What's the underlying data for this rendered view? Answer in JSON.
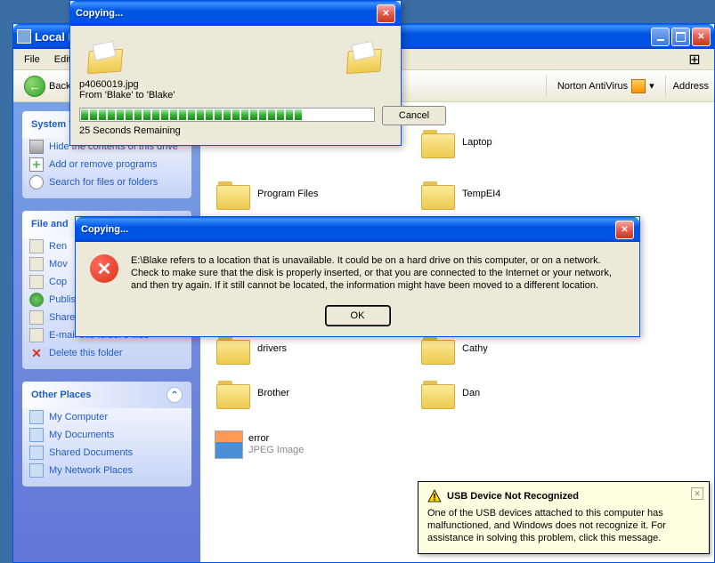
{
  "explorer": {
    "title": "Local Di",
    "menu": {
      "file": "File",
      "edit": "Edit"
    },
    "toolbar": {
      "back": "Back",
      "norton": "Norton AntiVirus",
      "address": "Address"
    },
    "panels": {
      "system": {
        "header": "System Tasks",
        "hide": "Hide the contents of this drive",
        "addremove": "Add or remove programs",
        "search": "Search for files or folders"
      },
      "file": {
        "header": "File and",
        "rename": "Ren",
        "move": "Mov",
        "copy": "Cop",
        "publish": "Publish this folder to the Web",
        "share": "Share this folder",
        "email": "E-mail this folder's files",
        "delete": "Delete this folder"
      },
      "other": {
        "header": "Other Places",
        "mycomputer": "My Computer",
        "mydocs": "My Documents",
        "shared": "Shared Documents",
        "network": "My Network Places"
      }
    },
    "items": {
      "col2": [
        {
          "label": "Program Files"
        },
        {
          "label": "drivers"
        },
        {
          "label": "Brother"
        },
        {
          "label": "error",
          "sub": "JPEG Image",
          "type": "jpeg"
        }
      ],
      "col3": [
        {
          "label": "Laptop"
        },
        {
          "label": "TempEI4"
        },
        {
          "label": "Cathy"
        },
        {
          "label": "Dan"
        }
      ]
    }
  },
  "copy_dialog": {
    "title": "Copying...",
    "filename": "p4060019.jpg",
    "fromto": "From 'Blake' to 'Blake'",
    "remaining": "25 Seconds Remaining",
    "cancel": "Cancel",
    "progress_segments": 25
  },
  "error_dialog": {
    "title": "Copying...",
    "message": "E:\\Blake refers to a location that is unavailable. It could be on a hard drive on this computer, or on a network. Check to make sure that the disk is properly inserted, or that you are connected to the Internet or your network, and then try again. If it still cannot be located, the information might have been moved to a different location.",
    "ok": "OK"
  },
  "balloon": {
    "title": "USB Device Not Recognized",
    "body": "One of the USB devices attached to this computer has malfunctioned, and Windows does not recognize it. For assistance in solving this problem, click this message."
  }
}
